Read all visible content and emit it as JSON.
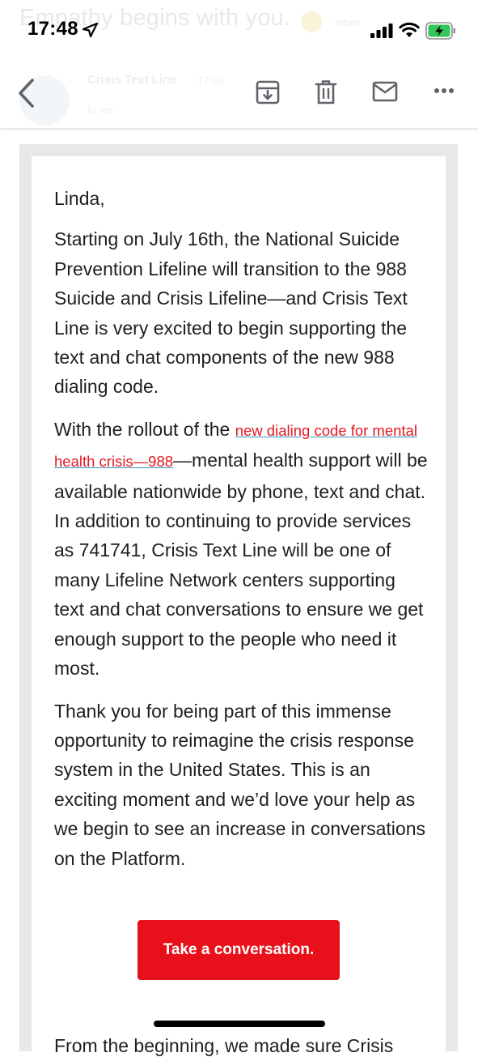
{
  "background": {
    "ghost_subject": "Empathy begins with you.",
    "ghost_label": "Inbox",
    "ghost_sender": "Crisis Text Line",
    "ghost_time": "17:00",
    "ghost_to": "to me"
  },
  "status_bar": {
    "time": "17:48"
  },
  "toolbar": {
    "back_icon": "chevron-left-icon",
    "archive_icon": "archive-box-icon",
    "trash_icon": "trash-icon",
    "mail_icon": "envelope-icon",
    "more_icon": "more-horizontal-icon"
  },
  "email": {
    "greeting": "Linda,",
    "paragraph1": "Starting on July 16th, the National Suicide Prevention Lifeline will transition to the 988 Suicide and Crisis Lifeline—and Crisis Text Line is very excited to begin supporting the text and chat components of the new 988 dialing code.",
    "paragraph2_before": "With the rollout of the ",
    "paragraph2_link": "new dialing code for mental health crisis—988",
    "paragraph2_after": "—mental health support will be available nationwide by phone, text and chat. In addition to continuing to provide services as 741741, Crisis Text Line will be one of many Lifeline Network centers supporting text and chat conversations to ensure we get enough support to the people who need it most.",
    "paragraph3": "Thank you for being part of this immense opportunity to reimagine the crisis response system in the United States. This is an exciting moment and we’d love your help as we begin to see an increase in conversations on the Platform.",
    "cta_label": "Take a conversation.",
    "bottom_peek": "From the beginning, we made sure Crisis"
  },
  "colors": {
    "accent": "#e8101a",
    "link": "#e41822",
    "link_underline": "#3a8fb5",
    "battery_charge": "#34c759"
  }
}
